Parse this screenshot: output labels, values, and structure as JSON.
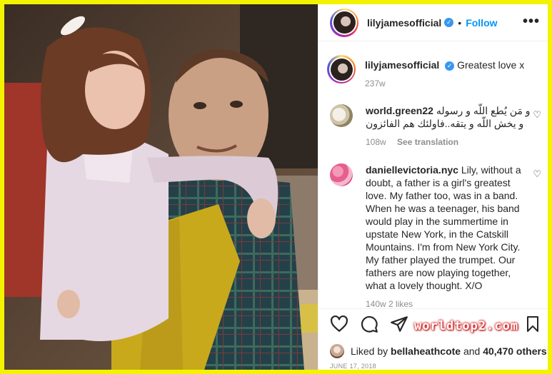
{
  "post": {
    "username": "lilyjamesofficial",
    "follow_label": "Follow",
    "dot": "•",
    "more": "•••"
  },
  "caption": {
    "username": "lilyjamesofficial",
    "text": "Greatest love x",
    "age": "237w"
  },
  "comments": [
    {
      "username": "world.green22",
      "line1": "و مَن يُطع اللّه و رسوله",
      "line2": "و يخش اللّه و يتقه..فاولئك هم الفائزون",
      "age": "108w",
      "translate": "See translation"
    },
    {
      "username": "daniellevictoria.nyc",
      "text": "Lily, without a doubt, a father is a girl's greatest love. My father too, was in a band. When he was a teenager, his band would play in the summertime in upstate New York, in the Catskill Mountains. I'm from New York City. My father played the trumpet. Our fathers are now playing together, what a lovely thought. X/O",
      "partial_meta": "140w  2 likes"
    }
  ],
  "watermark": "worldtop2.com",
  "likes": {
    "prefix": "Liked by",
    "user": "bellaheathcote",
    "and": "and",
    "others": "40,470 others"
  },
  "date": "JUNE 17, 2018",
  "icons": [
    "verified-badge-icon",
    "more-icon",
    "heart-icon",
    "comment-icon",
    "share-icon",
    "bookmark-icon"
  ],
  "colors": {
    "frame": "#f3f300",
    "follow": "#0095f6",
    "verified": "#3897f0",
    "muted": "#8e8e8e"
  }
}
